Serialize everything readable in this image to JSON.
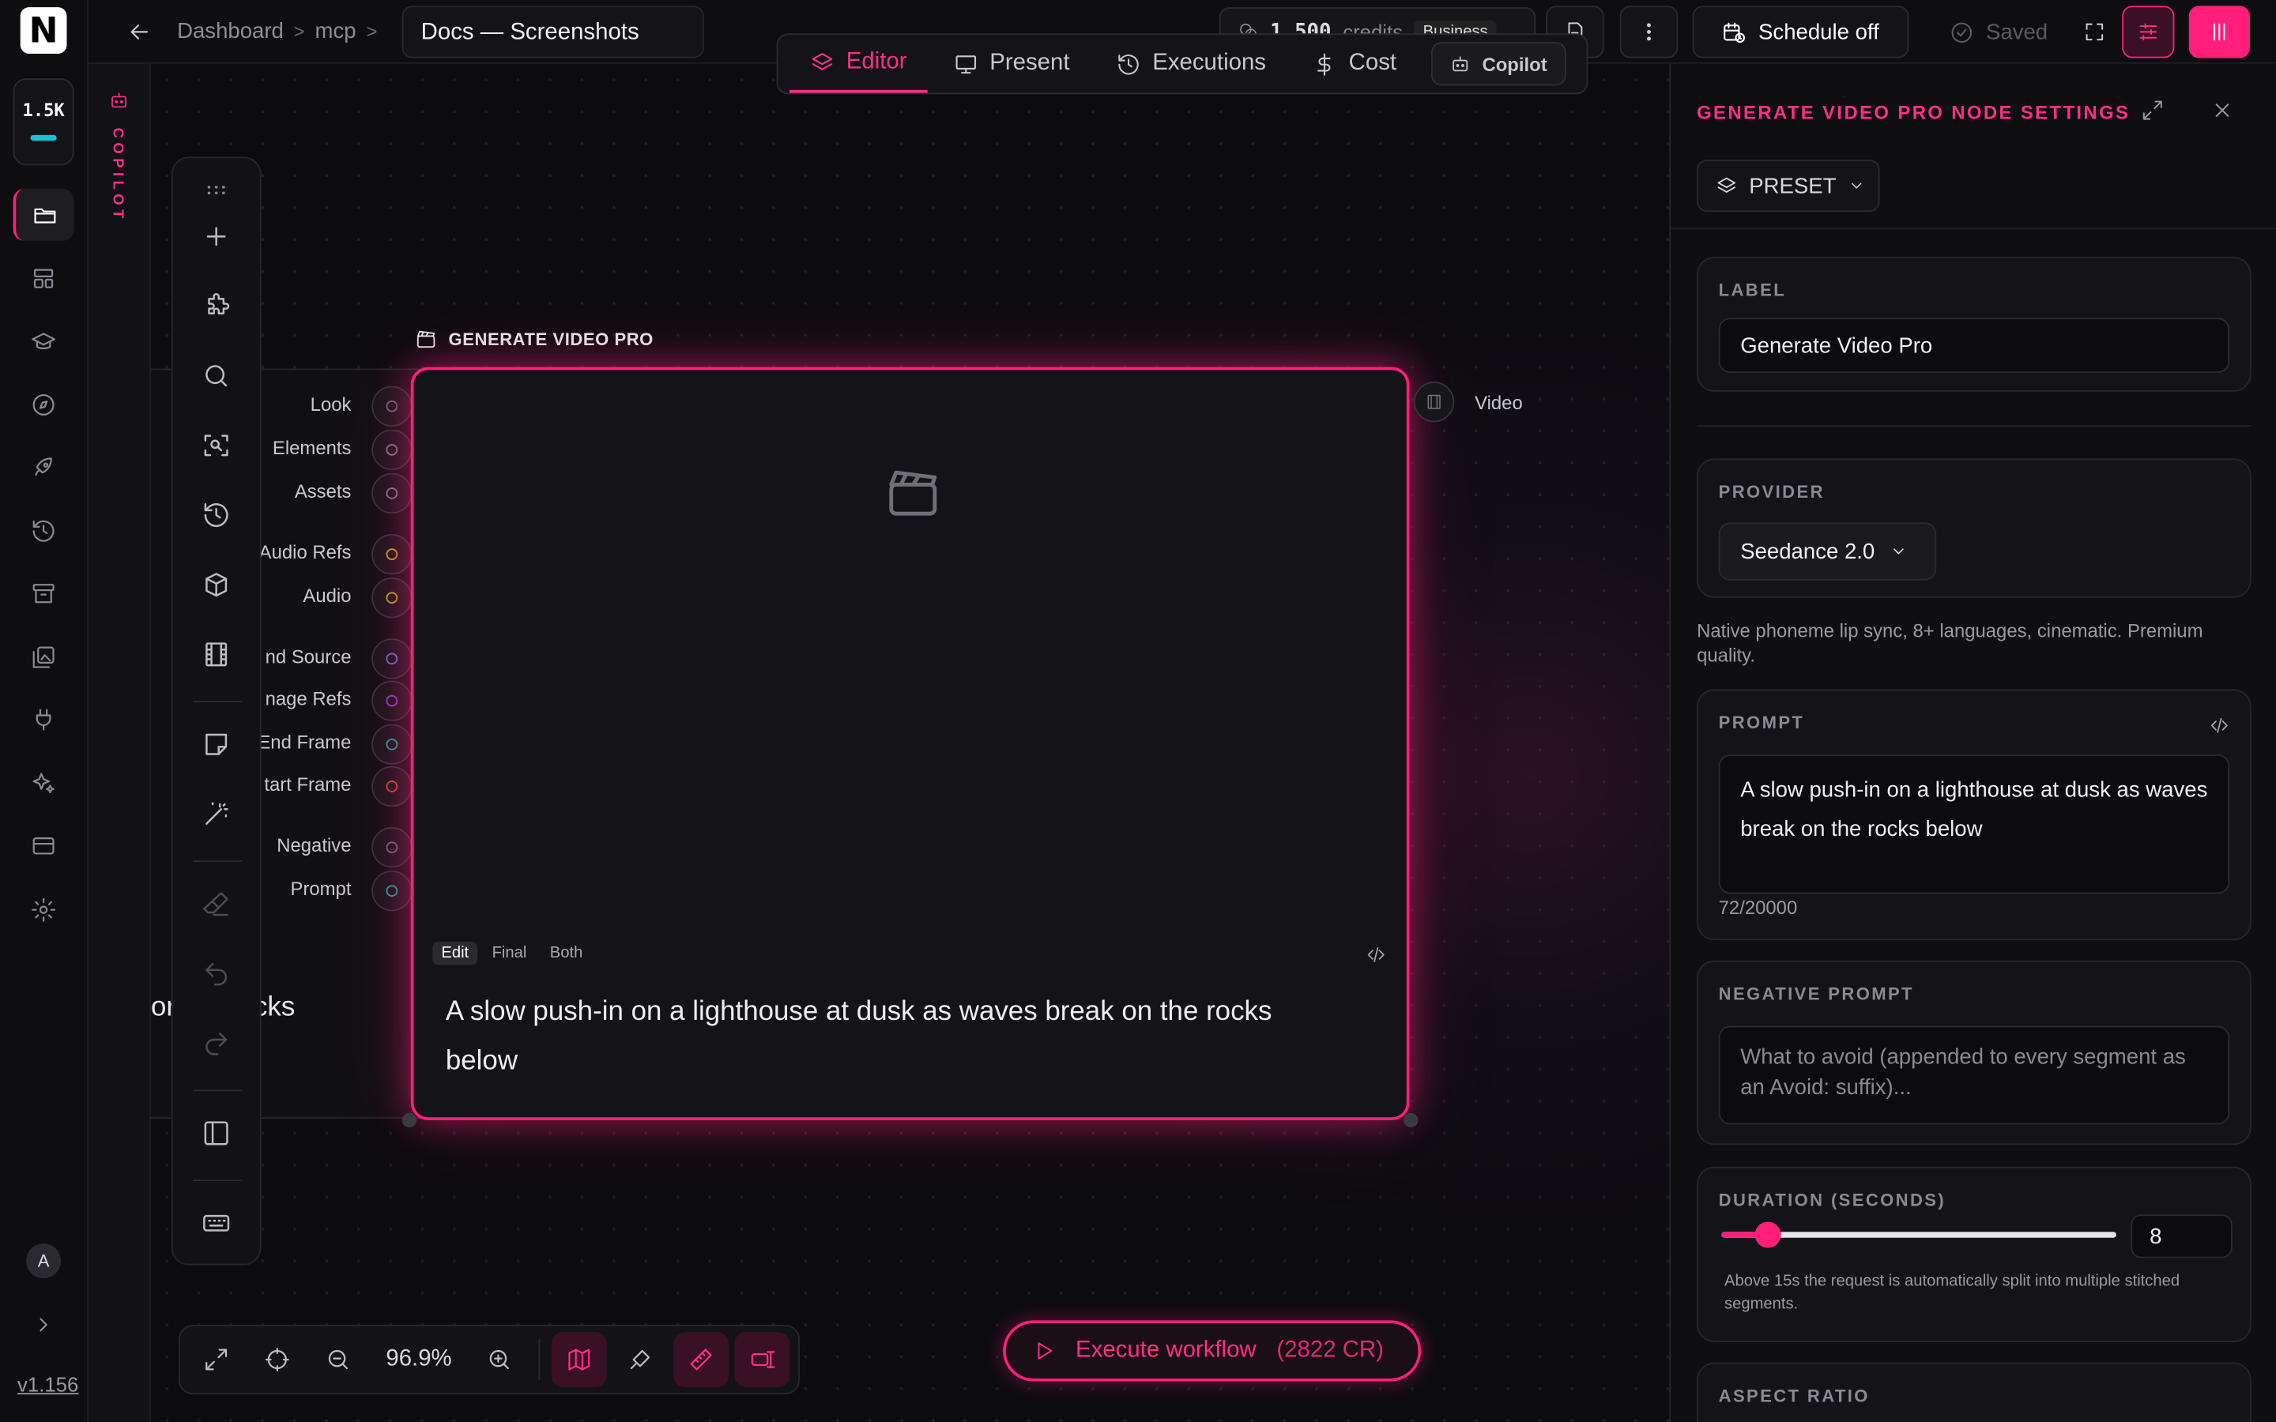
{
  "app": {
    "logo_letter": "N",
    "credits_short": "1.5K",
    "version": "v1.156",
    "avatar_letter": "A"
  },
  "topbar": {
    "breadcrumb": [
      "Dashboard",
      "mcp"
    ],
    "doc_title": "Docs — Screenshots",
    "credits_amount": "1,500",
    "credits_label": "credits",
    "tier": "Business",
    "schedule_label": "Schedule off",
    "saved_label": "Saved"
  },
  "mode_tabs": [
    {
      "label": "Editor",
      "icon": "layers-icon",
      "active": true
    },
    {
      "label": "Present",
      "icon": "monitor-icon"
    },
    {
      "label": "Executions",
      "icon": "history-icon"
    },
    {
      "label": "Cost",
      "icon": "dollar-icon"
    },
    {
      "label": "Copilot",
      "icon": "bot-icon"
    }
  ],
  "copilot_strip": {
    "label": "COPILOT"
  },
  "canvas": {
    "prev_node_text": "or the rocks",
    "node": {
      "header": "GENERATE VIDEO PRO",
      "inputs": [
        {
          "label": "Look",
          "color": "#6b6b74"
        },
        {
          "label": "Elements",
          "color": "#7b7b84"
        },
        {
          "label": "Assets",
          "color": "#7b7b84"
        },
        {
          "label": "Audio Refs",
          "color": "#c8a026"
        },
        {
          "label": "Audio",
          "color": "#c8a026"
        },
        {
          "label": "nd Source",
          "color": "#6b6bd0"
        },
        {
          "label": "nage Refs",
          "color": "#8a3fd0"
        },
        {
          "label": "End Frame",
          "color": "#19a6a0"
        },
        {
          "label": "tart Frame",
          "color": "#d04040"
        },
        {
          "label": "Negative",
          "color": "#6b6b74"
        },
        {
          "label": "Prompt",
          "color": "#19a6a0"
        }
      ],
      "output_label": "Video",
      "view_tabs": [
        "Edit",
        "Final",
        "Both"
      ],
      "prompt_text": "A slow push-in on a lighthouse at dusk as waves break on the rocks below"
    },
    "zoom": "96.9%",
    "execute_label": "Execute workflow",
    "execute_cost": "(2822 CR)"
  },
  "panel": {
    "title": "GENERATE VIDEO PRO NODE SETTINGS",
    "preset_label": "PRESET",
    "label_caption": "LABEL",
    "label_value": "Generate Video Pro",
    "provider_caption": "PROVIDER",
    "provider_value": "Seedance 2.0",
    "provider_desc": "Native phoneme lip sync, 8+ languages, cinematic. Premium quality.",
    "prompt_caption": "PROMPT",
    "prompt_value": "A slow push-in on a lighthouse at dusk as waves break on the rocks below",
    "prompt_count": "72/20000",
    "negative_caption": "NEGATIVE PROMPT",
    "negative_placeholder": "What to avoid (appended to every segment as an Avoid: suffix)...",
    "duration_caption": "DURATION (SECONDS)",
    "duration_value": "8",
    "duration_min": 1,
    "duration_max": 60,
    "duration_note": "Above 15s the request is automatically split into multiple stitched segments.",
    "aspect_caption": "ASPECT RATIO"
  },
  "colors": {
    "accent": "#ff1f7a",
    "credit_bar": "#19c1d6"
  }
}
